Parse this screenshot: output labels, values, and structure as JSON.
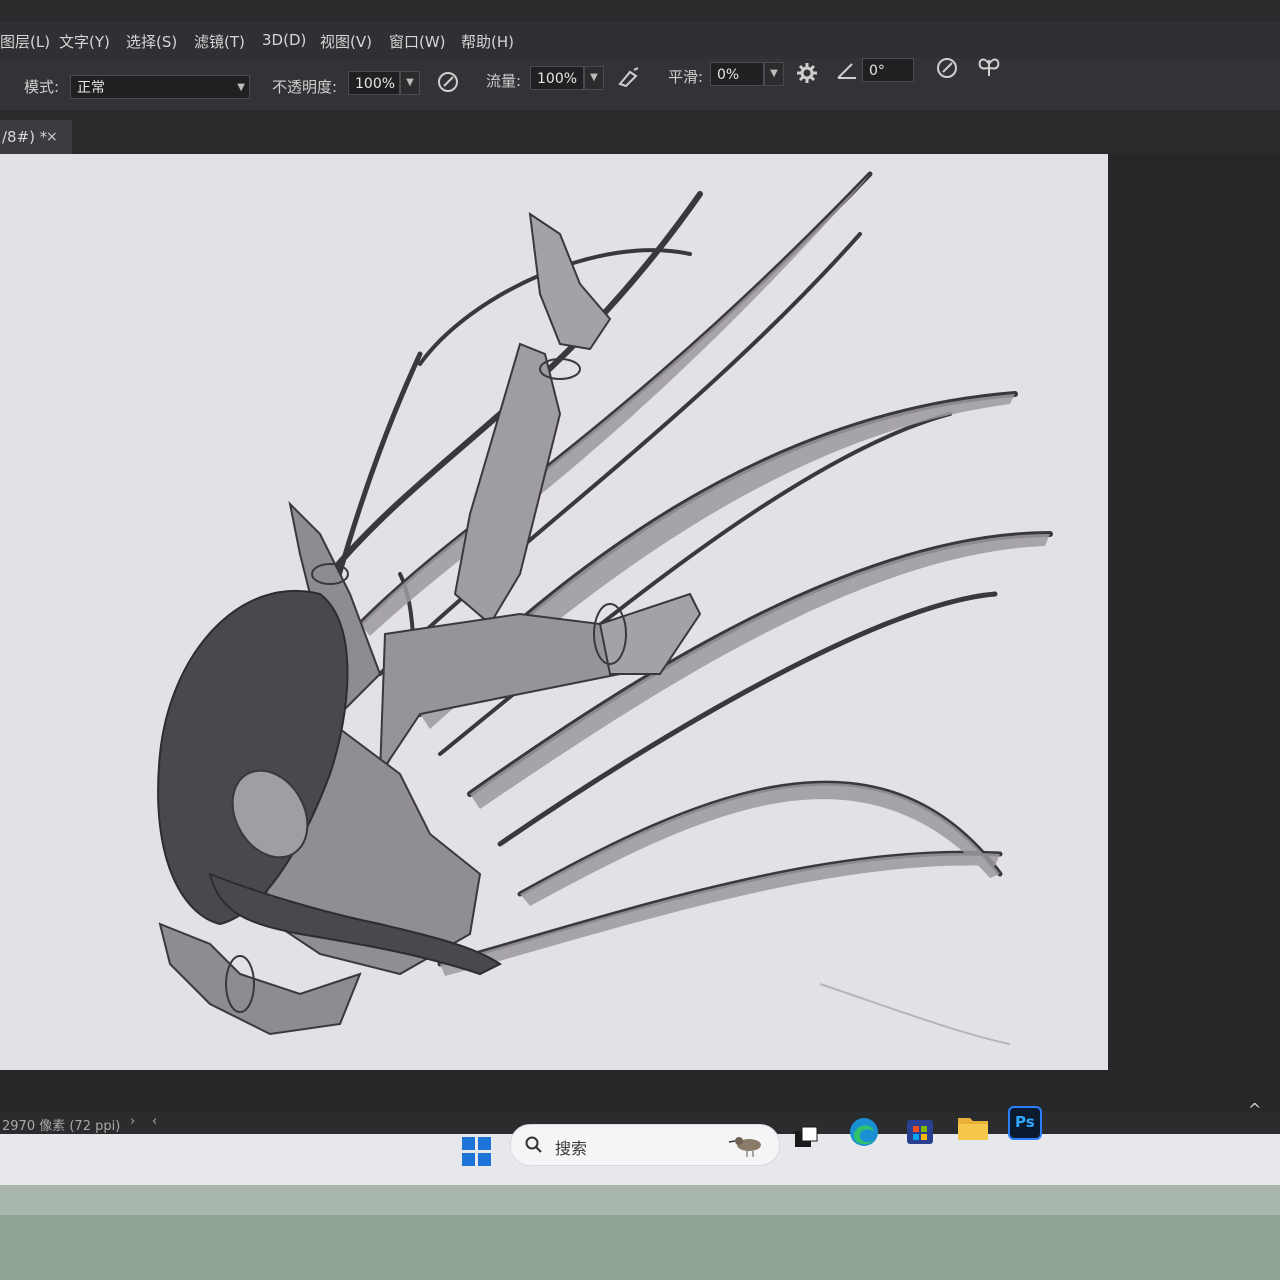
{
  "menu": [
    "图层(L)",
    "文字(Y)",
    "选择(S)",
    "滤镜(T)",
    "3D(D)",
    "视图(V)",
    "窗口(W)",
    "帮助(H)"
  ],
  "options": {
    "mode_label": "模式:",
    "mode_value": "正常",
    "opacity_label": "不透明度:",
    "opacity_value": "100%",
    "flow_label": "流量:",
    "flow_value": "100%",
    "smoothing_label": "平滑:",
    "smoothing_value": "0%",
    "angle_value": "0°"
  },
  "document": {
    "tab_label": "/8#) *",
    "close_symbol": "×"
  },
  "status": {
    "text": "2970 像素 (72 ppi)",
    "arrow_right": "›",
    "arrow_left": "‹"
  },
  "taskbar": {
    "search_placeholder": "搜索",
    "ps_label": "Ps",
    "chevron": "^"
  },
  "colors": {
    "canvas": "#e4e1e6",
    "line": "#3a383c",
    "hair": "#4a484d",
    "skin": "#8f8b92",
    "cloth": "#9d99a0"
  }
}
